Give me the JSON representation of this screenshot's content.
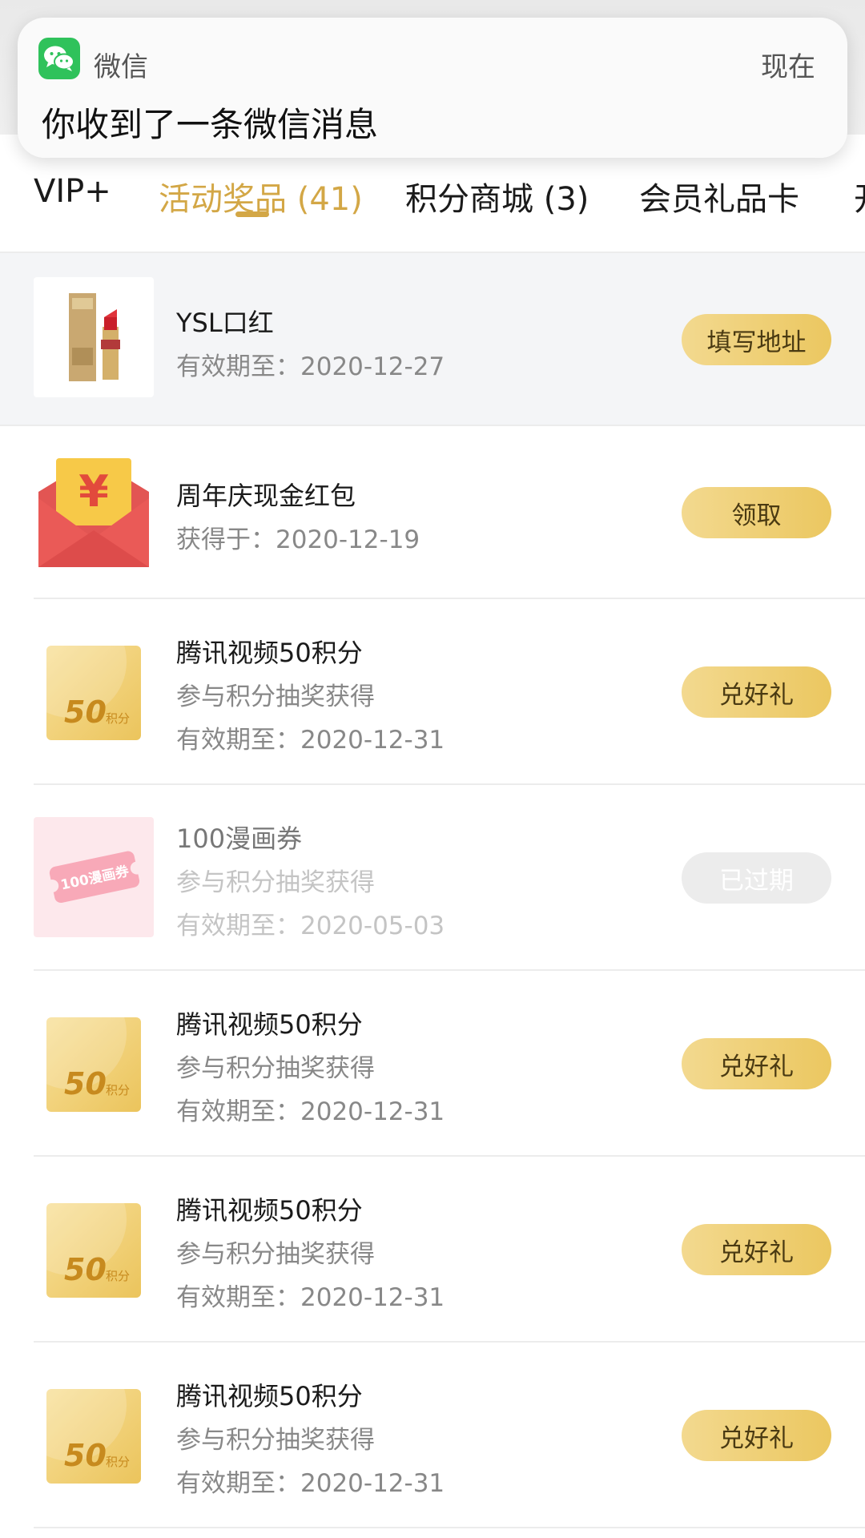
{
  "notification": {
    "app_name": "微信",
    "time": "现在",
    "message": "你收到了一条微信消息"
  },
  "tabs": [
    {
      "label": "VIP+",
      "active": false
    },
    {
      "label": "活动奖品 (41)",
      "active": true
    },
    {
      "label": "积分商城 (3)",
      "active": false
    },
    {
      "label": "会员礼品卡",
      "active": false
    },
    {
      "label": "开",
      "active": false
    }
  ],
  "items": [
    {
      "title": "YSL口红",
      "lines": [
        "有效期至：2020-12-27"
      ],
      "action": "填写地址",
      "thumb_icon": "lipstick-icon",
      "highlighted": true,
      "expired": false
    },
    {
      "title": "周年庆现金红包",
      "lines": [
        "获得于：2020-12-19"
      ],
      "action": "领取",
      "thumb_icon": "red-envelope-icon",
      "thumb_text": "¥",
      "highlighted": false,
      "expired": false
    },
    {
      "title": "腾讯视频50积分",
      "lines": [
        "参与积分抽奖获得",
        "有效期至：2020-12-31"
      ],
      "action": "兑好礼",
      "thumb_icon": "points-coupon-icon",
      "thumb_number": "50",
      "thumb_unit": "积分",
      "highlighted": false,
      "expired": false
    },
    {
      "title": "100漫画券",
      "lines": [
        "参与积分抽奖获得",
        "有效期至：2020-05-03"
      ],
      "action": "已过期",
      "thumb_icon": "comic-ticket-icon",
      "thumb_text": "100漫画券",
      "highlighted": false,
      "expired": true
    },
    {
      "title": "腾讯视频50积分",
      "lines": [
        "参与积分抽奖获得",
        "有效期至：2020-12-31"
      ],
      "action": "兑好礼",
      "thumb_icon": "points-coupon-icon",
      "thumb_number": "50",
      "thumb_unit": "积分",
      "highlighted": false,
      "expired": false
    },
    {
      "title": "腾讯视频50积分",
      "lines": [
        "参与积分抽奖获得",
        "有效期至：2020-12-31"
      ],
      "action": "兑好礼",
      "thumb_icon": "points-coupon-icon",
      "thumb_number": "50",
      "thumb_unit": "积分",
      "highlighted": false,
      "expired": false
    },
    {
      "title": "腾讯视频50积分",
      "lines": [
        "参与积分抽奖获得",
        "有效期至：2020-12-31"
      ],
      "action": "兑好礼",
      "thumb_icon": "points-coupon-icon",
      "thumb_number": "50",
      "thumb_unit": "积分",
      "highlighted": false,
      "expired": false
    }
  ],
  "colors": {
    "accent": "#d3a746",
    "button_gold": "#ebc760",
    "wechat_green": "#2fc25b",
    "envelope_red": "#e8504f",
    "expired_gray": "#ececec"
  }
}
